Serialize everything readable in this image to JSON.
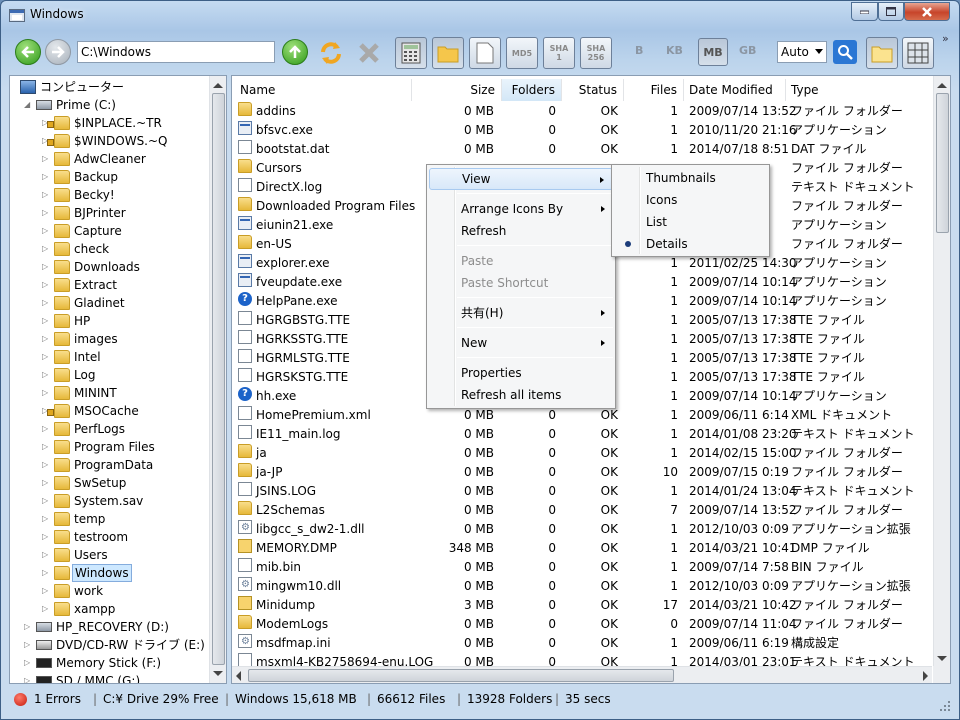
{
  "window": {
    "title": "Windows"
  },
  "toolbar": {
    "address": "C:\\Windows",
    "sha1_label": "SHA\n1",
    "sha256_label": "SHA\n256",
    "md5_label": "MD5",
    "units": [
      "B",
      "KB",
      "MB",
      "GB"
    ],
    "selected_unit": "MB",
    "auto_combo": "Auto",
    "more": "»"
  },
  "tree": {
    "root": "コンピューター",
    "drive": "Prime (C:)",
    "folders": [
      "$INPLACE.~TR",
      "$WINDOWS.~Q",
      "AdwCleaner",
      "Backup",
      "Becky!",
      "BJPrinter",
      "Capture",
      "check",
      "Downloads",
      "Extract",
      "Gladinet",
      "HP",
      "images",
      "Intel",
      "Log",
      "MININT",
      "MSOCache",
      "PerfLogs",
      "Program Files",
      "ProgramData",
      "SwSetup",
      "System.sav",
      "temp",
      "testroom",
      "Users",
      "Windows",
      "work",
      "xampp"
    ],
    "selected": "Windows",
    "other_drives": [
      "HP_RECOVERY (D:)",
      "DVD/CD-RW ドライブ (E:)",
      "Memory Stick (F:)",
      "SD / MMC (G:)"
    ]
  },
  "columns": {
    "name": "Name",
    "size": "Size",
    "folders": "Folders",
    "status": "Status",
    "files": "Files",
    "date": "Date Modified",
    "type": "Type"
  },
  "rows": [
    {
      "icon": "folder",
      "name": "addins",
      "size": "0 MB",
      "folders": "0",
      "status": "OK",
      "files": "1",
      "date": "2009/07/14 13:52",
      "type": "ファイル フォルダー"
    },
    {
      "icon": "exe",
      "name": "bfsvc.exe",
      "size": "0 MB",
      "folders": "0",
      "status": "OK",
      "files": "1",
      "date": "2010/11/20 21:16",
      "type": "アプリケーション"
    },
    {
      "icon": "doc",
      "name": "bootstat.dat",
      "size": "0 MB",
      "folders": "0",
      "status": "OK",
      "files": "1",
      "date": "2014/07/18 8:51",
      "type": "DAT ファイル"
    },
    {
      "icon": "folder",
      "name": "Cursors",
      "size": "",
      "folders": "",
      "status": "",
      "files": "",
      "date": "",
      "type": "ファイル フォルダー"
    },
    {
      "icon": "doc",
      "name": "DirectX.log",
      "size": "",
      "folders": "",
      "status": "",
      "files": "",
      "date": "",
      "type": "テキスト ドキュメント"
    },
    {
      "icon": "folder",
      "name": "Downloaded Program Files",
      "size": "",
      "folders": "",
      "status": "",
      "files": "",
      "date": "",
      "type": "ファイル フォルダー"
    },
    {
      "icon": "exe",
      "name": "eiunin21.exe",
      "size": "",
      "folders": "",
      "status": "",
      "files": "",
      "date": "",
      "type": "アプリケーション"
    },
    {
      "icon": "folder",
      "name": "en-US",
      "size": "",
      "folders": "",
      "status": "",
      "files": "",
      "date": "",
      "type": "ファイル フォルダー"
    },
    {
      "icon": "exe",
      "name": "explorer.exe",
      "size": "",
      "folders": "",
      "status": "",
      "files": "1",
      "date": "2011/02/25 14:30",
      "type": "アプリケーション"
    },
    {
      "icon": "exe",
      "name": "fveupdate.exe",
      "size": "",
      "folders": "",
      "status": "",
      "files": "1",
      "date": "2009/07/14 10:14",
      "type": "アプリケーション"
    },
    {
      "icon": "help",
      "name": "HelpPane.exe",
      "size": "",
      "folders": "",
      "status": "",
      "files": "1",
      "date": "2009/07/14 10:14",
      "type": "アプリケーション"
    },
    {
      "icon": "doc",
      "name": "HGRGBSTG.TTE",
      "size": "",
      "folders": "",
      "status": "",
      "files": "1",
      "date": "2005/07/13 17:38",
      "type": "TTE ファイル"
    },
    {
      "icon": "doc",
      "name": "HGRKSSTG.TTE",
      "size": "",
      "folders": "",
      "status": "",
      "files": "1",
      "date": "2005/07/13 17:38",
      "type": "TTE ファイル"
    },
    {
      "icon": "doc",
      "name": "HGRMLSTG.TTE",
      "size": "",
      "folders": "",
      "status": "",
      "files": "1",
      "date": "2005/07/13 17:38",
      "type": "TTE ファイル"
    },
    {
      "icon": "doc",
      "name": "HGRSKSTG.TTE",
      "size": "",
      "folders": "",
      "status": "",
      "files": "1",
      "date": "2005/07/13 17:38",
      "type": "TTE ファイル"
    },
    {
      "icon": "help",
      "name": "hh.exe",
      "size": "",
      "folders": "",
      "status": "",
      "files": "1",
      "date": "2009/07/14 10:14",
      "type": "アプリケーション"
    },
    {
      "icon": "doc",
      "name": "HomePremium.xml",
      "size": "0 MB",
      "folders": "0",
      "status": "OK",
      "files": "1",
      "date": "2009/06/11 6:14",
      "type": "XML ドキュメント"
    },
    {
      "icon": "doc",
      "name": "IE11_main.log",
      "size": "0 MB",
      "folders": "0",
      "status": "OK",
      "files": "1",
      "date": "2014/01/08 23:20",
      "type": "テキスト ドキュメント"
    },
    {
      "icon": "folder",
      "name": "ja",
      "size": "0 MB",
      "folders": "0",
      "status": "OK",
      "files": "1",
      "date": "2014/02/15 15:00",
      "type": "ファイル フォルダー"
    },
    {
      "icon": "folder",
      "name": "ja-JP",
      "size": "0 MB",
      "folders": "0",
      "status": "OK",
      "files": "10",
      "date": "2009/07/15 0:19",
      "type": "ファイル フォルダー"
    },
    {
      "icon": "doc",
      "name": "JSINS.LOG",
      "size": "0 MB",
      "folders": "0",
      "status": "OK",
      "files": "1",
      "date": "2014/01/24 13:04",
      "type": "テキスト ドキュメント"
    },
    {
      "icon": "folder",
      "name": "L2Schemas",
      "size": "0 MB",
      "folders": "0",
      "status": "OK",
      "files": "7",
      "date": "2009/07/14 13:52",
      "type": "ファイル フォルダー"
    },
    {
      "icon": "dll",
      "name": "libgcc_s_dw2-1.dll",
      "size": "0 MB",
      "folders": "0",
      "status": "OK",
      "files": "1",
      "date": "2012/10/03 0:09",
      "type": "アプリケーション拡張"
    },
    {
      "icon": "lock",
      "name": "MEMORY.DMP",
      "size": "348 MB",
      "folders": "0",
      "status": "OK",
      "files": "1",
      "date": "2014/03/21 10:41",
      "type": "DMP ファイル"
    },
    {
      "icon": "doc",
      "name": "mib.bin",
      "size": "0 MB",
      "folders": "0",
      "status": "OK",
      "files": "1",
      "date": "2009/07/14 7:58",
      "type": "BIN ファイル"
    },
    {
      "icon": "dll",
      "name": "mingwm10.dll",
      "size": "0 MB",
      "folders": "0",
      "status": "OK",
      "files": "1",
      "date": "2012/10/03 0:09",
      "type": "アプリケーション拡張"
    },
    {
      "icon": "lock",
      "name": "Minidump",
      "size": "3 MB",
      "folders": "0",
      "status": "OK",
      "files": "17",
      "date": "2014/03/21 10:42",
      "type": "ファイル フォルダー"
    },
    {
      "icon": "folder",
      "name": "ModemLogs",
      "size": "0 MB",
      "folders": "0",
      "status": "OK",
      "files": "0",
      "date": "2009/07/14 11:04",
      "type": "ファイル フォルダー"
    },
    {
      "icon": "dll",
      "name": "msdfmap.ini",
      "size": "0 MB",
      "folders": "0",
      "status": "OK",
      "files": "1",
      "date": "2009/06/11 6:19",
      "type": "構成設定"
    },
    {
      "icon": "doc",
      "name": "msxml4-KB2758694-enu.LOG",
      "size": "0 MB",
      "folders": "0",
      "status": "OK",
      "files": "1",
      "date": "2014/03/01 23:01",
      "type": "テキスト ドキュメント"
    }
  ],
  "context_menu": {
    "view": "View",
    "arrange": "Arrange Icons By",
    "refresh": "Refresh",
    "paste": "Paste",
    "paste_shortcut": "Paste Shortcut",
    "share": "共有(H)",
    "new": "New",
    "properties": "Properties",
    "refresh_all": "Refresh all items"
  },
  "view_submenu": {
    "items": [
      "Thumbnails",
      "Icons",
      "List",
      "Details"
    ],
    "checked": "Details"
  },
  "statusbar": {
    "errors": "1 Errors",
    "drive": "C:¥ Drive 29% Free",
    "windows": "Windows 15,618  MB",
    "files": "66612 Files",
    "folders": "13928 Folders",
    "time": "35 secs"
  },
  "colors": {
    "accent": "#2b77d4",
    "selection": "#cde8ff",
    "error": "#c41a0b"
  }
}
